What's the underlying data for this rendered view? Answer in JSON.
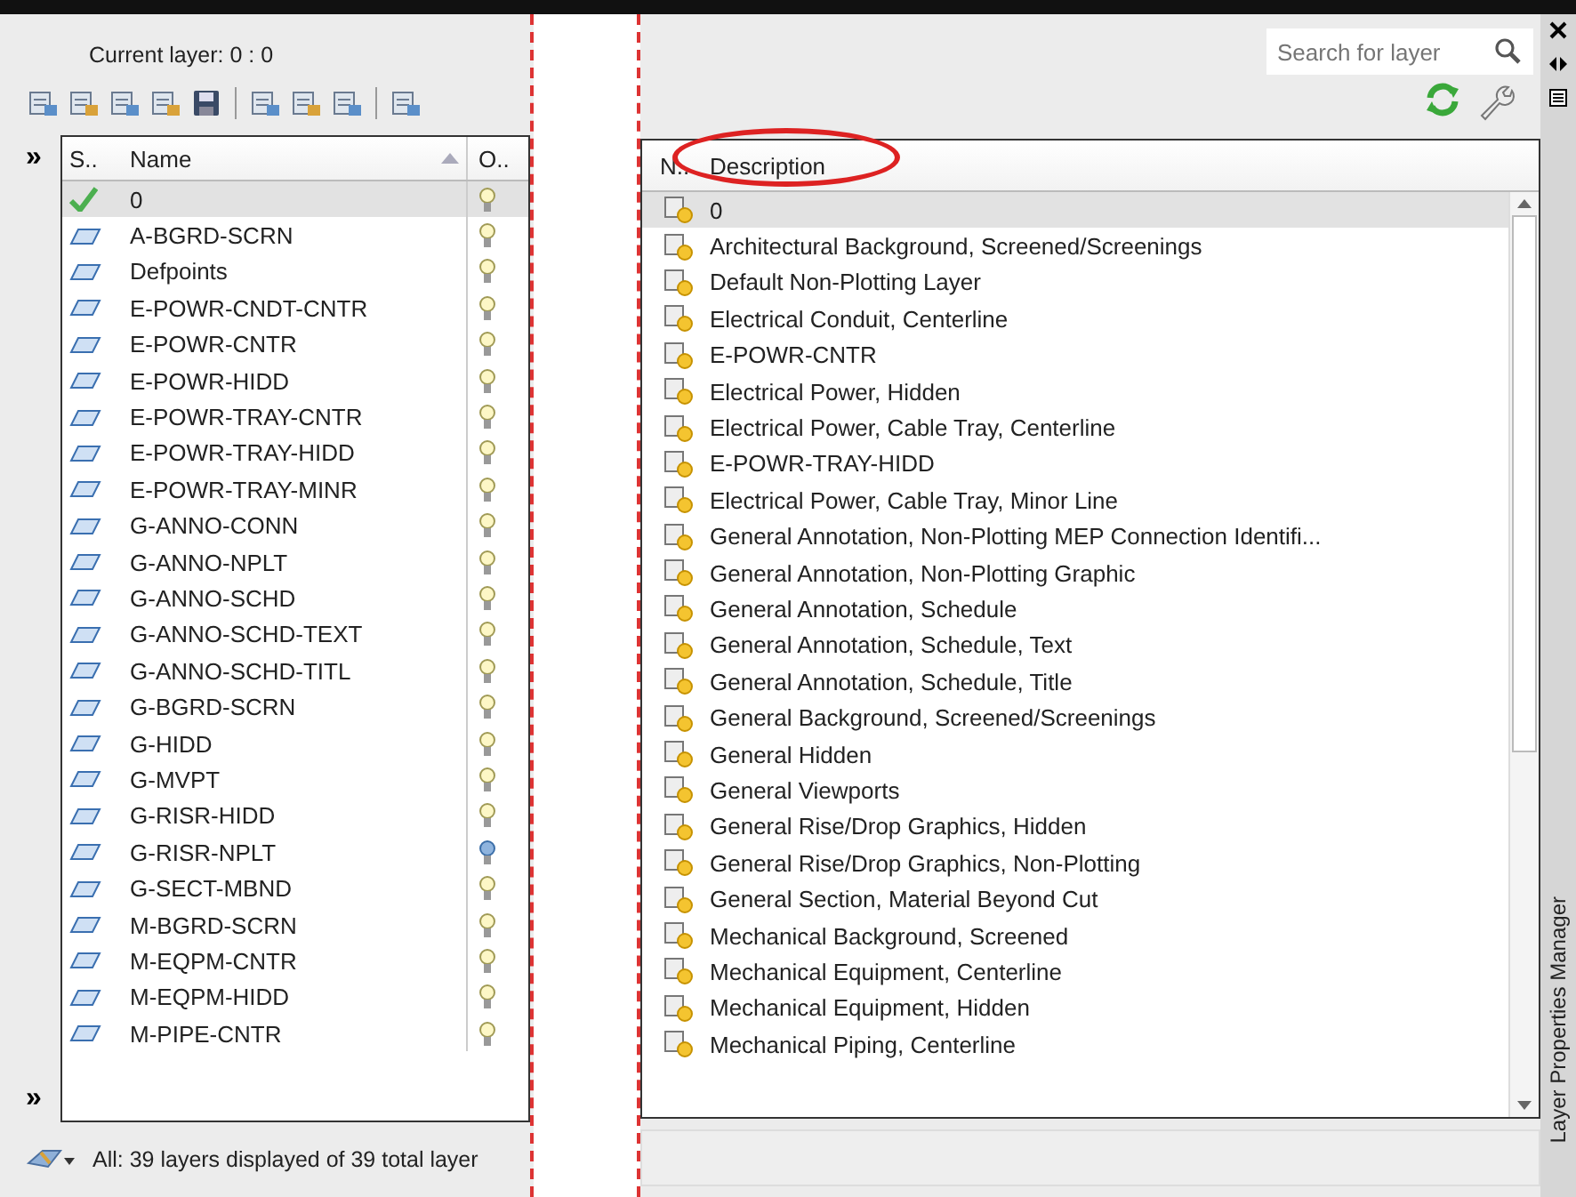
{
  "current_layer": "Current layer: 0 : 0",
  "search": {
    "placeholder": "Search for layer"
  },
  "left_columns": [
    "S..",
    "Name",
    "O.."
  ],
  "right_columns": [
    "N..",
    "Description"
  ],
  "expand_top": "»",
  "expand_bottom": "»",
  "layers": [
    {
      "name": "0",
      "description": "0",
      "current": true,
      "on": true,
      "selected": true
    },
    {
      "name": "A-BGRD-SCRN",
      "description": "Architectural Background, Screened/Screenings",
      "current": false,
      "on": true,
      "selected": false
    },
    {
      "name": "Defpoints",
      "description": "Default Non-Plotting Layer",
      "current": false,
      "on": true,
      "selected": false
    },
    {
      "name": "E-POWR-CNDT-CNTR",
      "description": "Electrical Conduit, Centerline",
      "current": false,
      "on": true,
      "selected": false
    },
    {
      "name": "E-POWR-CNTR",
      "description": "E-POWR-CNTR",
      "current": false,
      "on": true,
      "selected": false
    },
    {
      "name": "E-POWR-HIDD",
      "description": "Electrical Power, Hidden",
      "current": false,
      "on": true,
      "selected": false
    },
    {
      "name": "E-POWR-TRAY-CNTR",
      "description": "Electrical Power, Cable Tray, Centerline",
      "current": false,
      "on": true,
      "selected": false
    },
    {
      "name": "E-POWR-TRAY-HIDD",
      "description": "E-POWR-TRAY-HIDD",
      "current": false,
      "on": true,
      "selected": false
    },
    {
      "name": "E-POWR-TRAY-MINR",
      "description": "Electrical Power, Cable Tray, Minor Line",
      "current": false,
      "on": true,
      "selected": false
    },
    {
      "name": "G-ANNO-CONN",
      "description": "General Annotation, Non-Plotting MEP Connection Identifi...",
      "current": false,
      "on": true,
      "selected": false
    },
    {
      "name": "G-ANNO-NPLT",
      "description": "General Annotation, Non-Plotting Graphic",
      "current": false,
      "on": true,
      "selected": false
    },
    {
      "name": "G-ANNO-SCHD",
      "description": "General Annotation, Schedule",
      "current": false,
      "on": true,
      "selected": false
    },
    {
      "name": "G-ANNO-SCHD-TEXT",
      "description": "General Annotation, Schedule, Text",
      "current": false,
      "on": true,
      "selected": false
    },
    {
      "name": "G-ANNO-SCHD-TITL",
      "description": "General Annotation, Schedule, Title",
      "current": false,
      "on": true,
      "selected": false
    },
    {
      "name": "G-BGRD-SCRN",
      "description": "General Background, Screened/Screenings",
      "current": false,
      "on": true,
      "selected": false
    },
    {
      "name": "G-HIDD",
      "description": "General Hidden",
      "current": false,
      "on": true,
      "selected": false
    },
    {
      "name": "G-MVPT",
      "description": "General Viewports",
      "current": false,
      "on": true,
      "selected": false
    },
    {
      "name": "G-RISR-HIDD",
      "description": "General Rise/Drop Graphics, Hidden",
      "current": false,
      "on": true,
      "selected": false
    },
    {
      "name": "G-RISR-NPLT",
      "description": "General Rise/Drop Graphics, Non-Plotting",
      "current": false,
      "on": false,
      "selected": false
    },
    {
      "name": "G-SECT-MBND",
      "description": "General Section, Material Beyond Cut",
      "current": false,
      "on": true,
      "selected": false
    },
    {
      "name": "M-BGRD-SCRN",
      "description": "Mechanical Background, Screened",
      "current": false,
      "on": true,
      "selected": false
    },
    {
      "name": "M-EQPM-CNTR",
      "description": "Mechanical Equipment, Centerline",
      "current": false,
      "on": true,
      "selected": false
    },
    {
      "name": "M-EQPM-HIDD",
      "description": "Mechanical Equipment, Hidden",
      "current": false,
      "on": true,
      "selected": false
    },
    {
      "name": "M-PIPE-CNTR",
      "description": "Mechanical Piping, Centerline",
      "current": false,
      "on": true,
      "selected": false
    }
  ],
  "status": "All: 39 layers displayed of 39 total layer",
  "palette_title": "Layer Properties Manager"
}
